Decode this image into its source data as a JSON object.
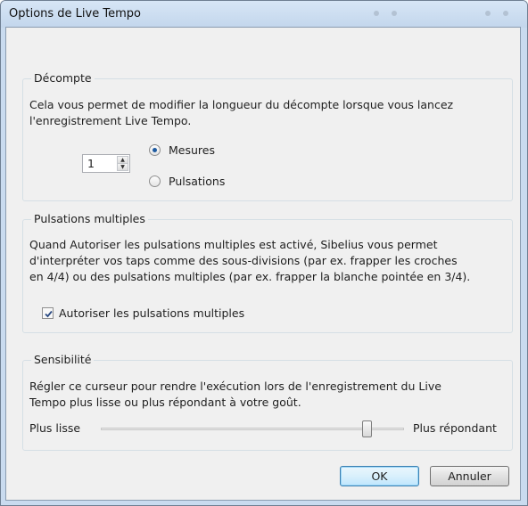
{
  "window": {
    "title": "Options de Live Tempo"
  },
  "countin": {
    "label": "Décompte",
    "description_line1": "Cela vous permet de modifier la longueur du décompte lorsque vous lancez",
    "description_line2": "l'enregistrement Live Tempo.",
    "value": "1",
    "options": [
      {
        "label": "Mesures",
        "selected": true
      },
      {
        "label": "Pulsations",
        "selected": false
      }
    ]
  },
  "multibeat": {
    "label": "Pulsations multiples",
    "description_line1": "Quand Autoriser les pulsations multiples est activé, Sibelius vous permet",
    "description_line2": "d'interpréter vos taps comme des sous-divisions (par ex. frapper les croches",
    "description_line3": "en 4/4) ou des pulsations multiples (par ex. frapper la blanche pointée en 3/4).",
    "checkbox_label": "Autoriser les pulsations multiples",
    "checked": true
  },
  "sensitivity": {
    "label": "Sensibilité",
    "description_line1": "Régler ce curseur pour rendre l'exécution lors de l'enregistrement du Live",
    "description_line2": "Tempo plus lisse ou plus répondant à votre goût.",
    "min_label": "Plus lisse",
    "max_label": "Plus répondant",
    "level": 0.88
  },
  "buttons": {
    "ok": "OK",
    "cancel": "Annuler"
  },
  "colors": {
    "frame": "#c9dbef",
    "default_button_border": "#3c7fb1",
    "radio_selected": "#1d5aa0"
  }
}
